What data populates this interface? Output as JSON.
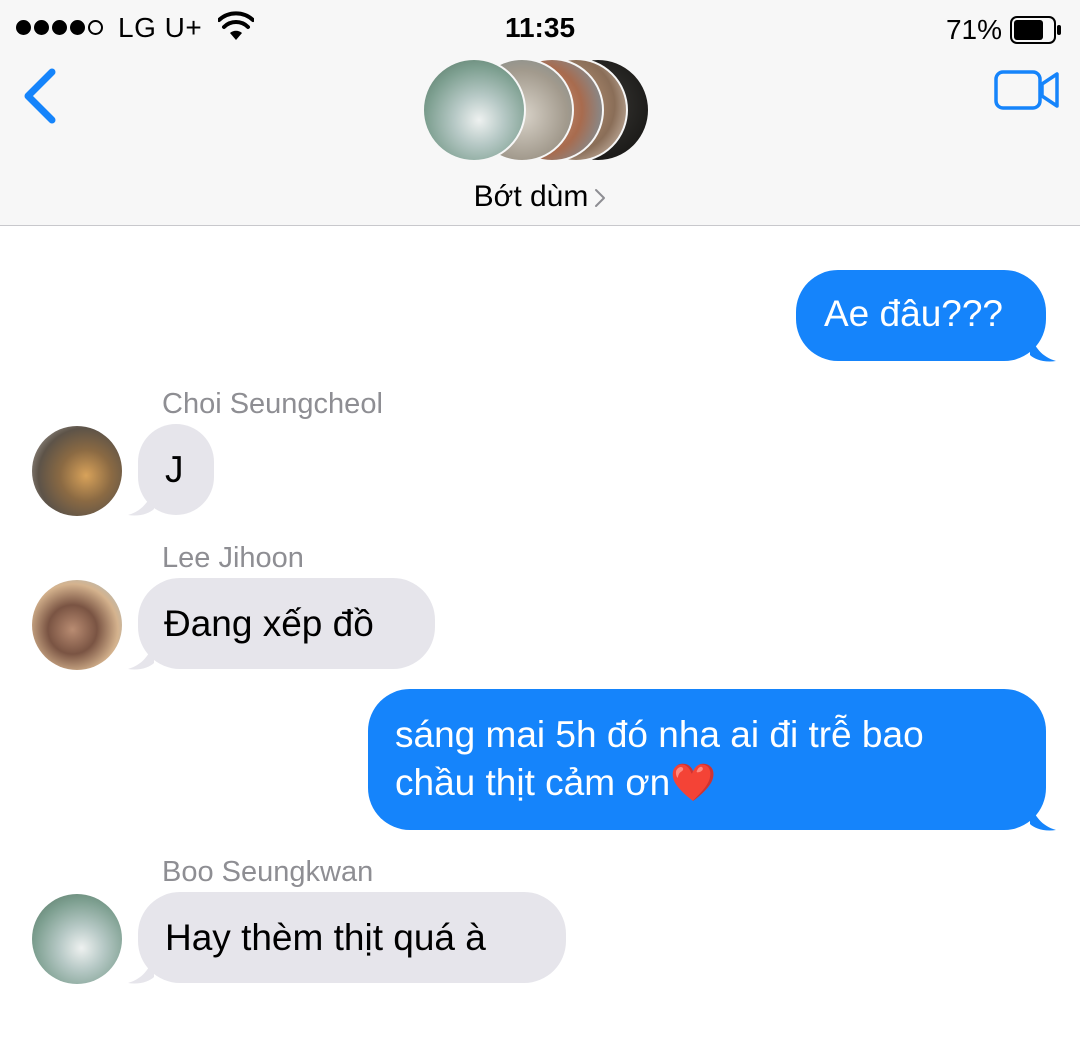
{
  "status_bar": {
    "carrier": "LG U+",
    "time": "11:35",
    "battery_percent": "71%",
    "signal_bars_filled": 4,
    "signal_bars_total": 5
  },
  "navigation": {
    "back_icon": "chevron-left-icon",
    "video_icon": "video-camera-icon",
    "conversation_title": "Bớt dùm",
    "title_chevron_icon": "chevron-right-icon",
    "accent_color": "#1584fb"
  },
  "messages": [
    {
      "direction": "outgoing",
      "text": "Ae đâu???"
    },
    {
      "direction": "incoming",
      "sender": "Choi Seungcheol",
      "text": "J"
    },
    {
      "direction": "incoming",
      "sender": "Lee Jihoon",
      "text": "Đang xếp đồ"
    },
    {
      "direction": "outgoing",
      "lines": [
        "sáng mai 5h đó nha ai đi trễ bao",
        "chầu thịt cảm ơn"
      ],
      "emoji": "❤️"
    },
    {
      "direction": "incoming",
      "sender": "Boo Seungkwan",
      "text": "Hay thèm thịt quá à"
    }
  ],
  "colors": {
    "outgoing_bubble": "#1584fb",
    "incoming_bubble": "#e6e5eb",
    "sender_name": "#8e8e93"
  }
}
